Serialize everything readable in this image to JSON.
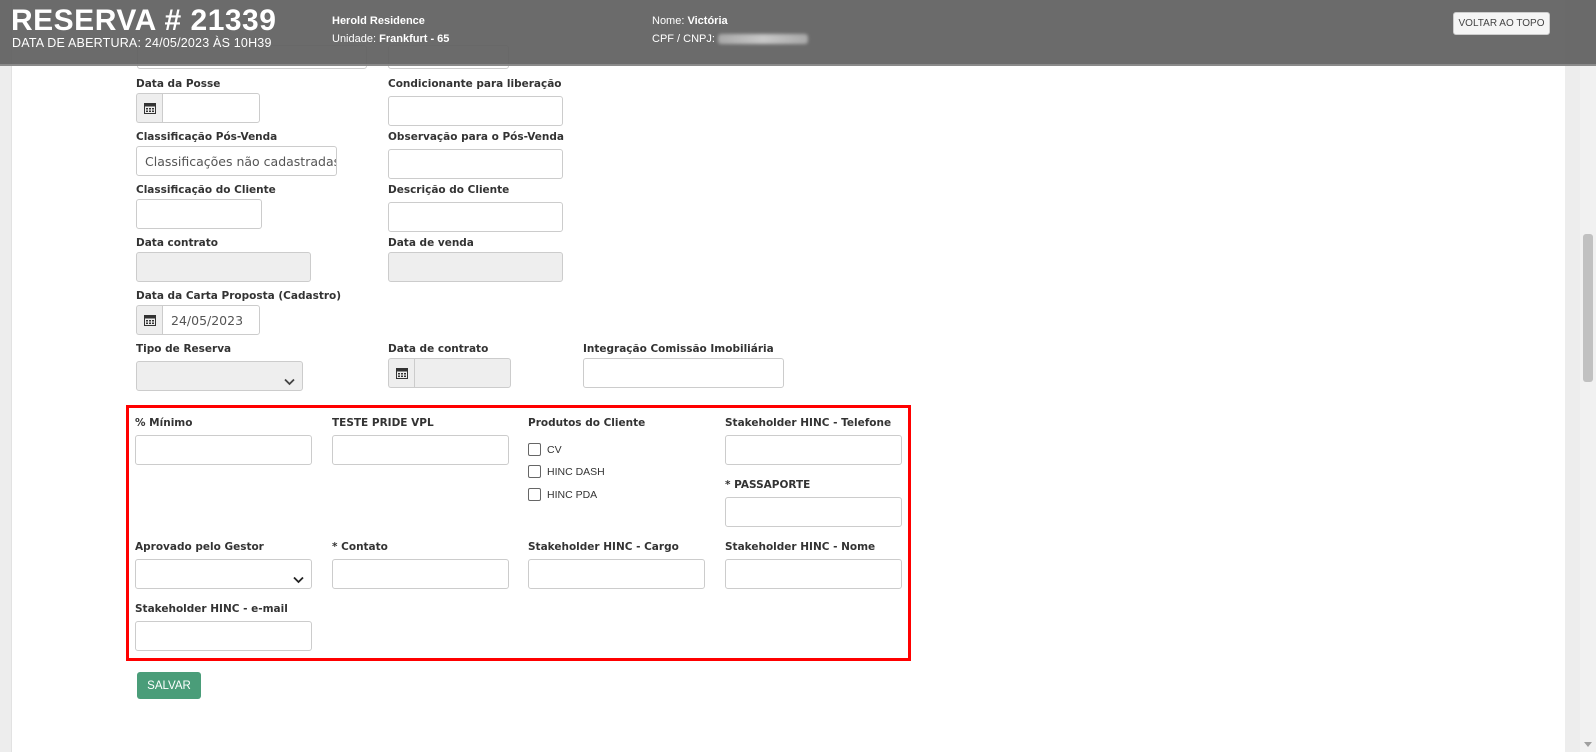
{
  "header": {
    "title": "RESERVA # 21339",
    "subtitle": "DATA DE ABERTURA: 24/05/2023 ÀS 10H39",
    "empreendimento": "Herold Residence",
    "unidade_label": "Unidade:",
    "unidade_value": "Frankfurt - 65",
    "nome_label": "Nome:",
    "nome_value": "Victória",
    "cpf_label": "CPF / CNPJ:",
    "back_to_top": "VOLTAR AO TOPO"
  },
  "form": {
    "data_posse": {
      "label": "Data da Posse",
      "value": ""
    },
    "condicionante": {
      "label": "Condicionante para liberação",
      "value": ""
    },
    "classificacao_pos_venda": {
      "label": "Classificação Pós-Venda",
      "value": "Classificações não cadastradas"
    },
    "observacao_pos_venda": {
      "label": "Observação para o Pós-Venda",
      "value": ""
    },
    "classificacao_cliente": {
      "label": "Classificação do Cliente",
      "value": ""
    },
    "descricao_cliente": {
      "label": "Descrição do Cliente",
      "value": ""
    },
    "data_contrato": {
      "label": "Data contrato",
      "value": ""
    },
    "data_venda": {
      "label": "Data de venda",
      "value": ""
    },
    "data_carta_proposta": {
      "label": "Data da Carta Proposta (Cadastro)",
      "value": "24/05/2023"
    },
    "tipo_reserva": {
      "label": "Tipo de Reserva",
      "value": ""
    },
    "data_de_contrato": {
      "label": "Data de contrato",
      "value": ""
    },
    "integracao_comissao": {
      "label": "Integração Comissão Imobiliária",
      "value": ""
    }
  },
  "custom": {
    "percent_minimo": {
      "label": "% Mínimo",
      "value": ""
    },
    "teste_pride": {
      "label": "TESTE PRIDE VPL",
      "value": ""
    },
    "produtos_cliente": {
      "label": "Produtos do Cliente",
      "options": [
        "CV",
        "HINC DASH",
        "HINC PDA"
      ]
    },
    "stakeholder_telefone": {
      "label": "Stakeholder HINC - Telefone",
      "value": ""
    },
    "passaporte": {
      "label": "* PASSAPORTE",
      "value": ""
    },
    "aprovado_gestor": {
      "label": "Aprovado pelo Gestor",
      "value": ""
    },
    "contato": {
      "label": "* Contato",
      "value": ""
    },
    "stakeholder_cargo": {
      "label": "Stakeholder HINC - Cargo",
      "value": ""
    },
    "stakeholder_nome": {
      "label": "Stakeholder HINC - Nome",
      "value": ""
    },
    "stakeholder_email": {
      "label": "Stakeholder HINC - e-mail",
      "value": ""
    }
  },
  "actions": {
    "save": "SALVAR"
  },
  "colors": {
    "header_bg": "#606060",
    "highlight": "#ff0000",
    "save_button": "#4a9d79"
  }
}
